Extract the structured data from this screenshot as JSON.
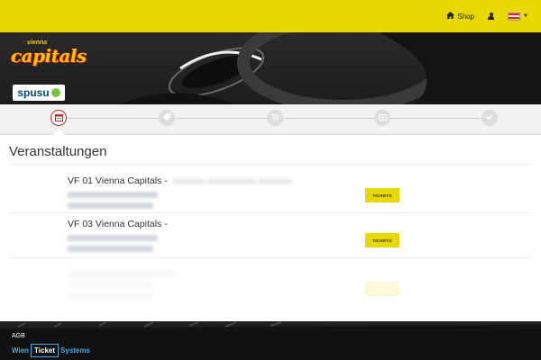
{
  "topbar": {
    "shop_label": "Shop",
    "shop_icon": "home-icon",
    "user_icon": "user-icon",
    "language_icon": "austria-flag-icon",
    "colors": {
      "bar": "#e6d800",
      "flag_red": "#e4202e",
      "flag_white": "#ffffff"
    }
  },
  "hero": {
    "club_name_small": "vienna",
    "club_name": "capitals",
    "sponsor": "spusu"
  },
  "steps": {
    "items": [
      {
        "icon": "calendar-icon",
        "active": true
      },
      {
        "icon": "tag-icon",
        "active": false
      },
      {
        "icon": "cart-icon",
        "active": false
      },
      {
        "icon": "ticket-icon",
        "active": false
      },
      {
        "icon": "check-icon",
        "active": false
      }
    ],
    "active_color": "#c62828"
  },
  "main": {
    "title": "Veranstaltungen",
    "events": [
      {
        "name": "VF 01 Vienna Capitals -",
        "button": "TICKETS"
      },
      {
        "name": "VF 03 Vienna Capitals -",
        "button": "TICKETS"
      }
    ]
  },
  "footer": {
    "agb": "AGB",
    "brand_left": "Wien",
    "brand_box": "Ticket",
    "brand_right": "Systems"
  }
}
